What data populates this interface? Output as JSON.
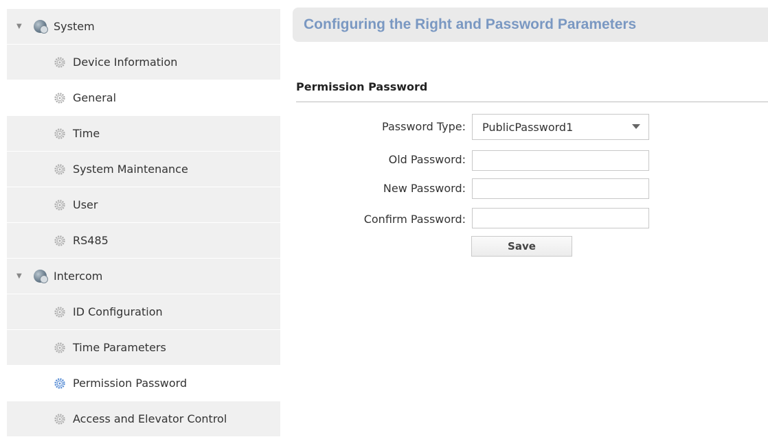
{
  "sidebar": {
    "groups": [
      {
        "label": "System",
        "items": [
          {
            "label": "Device Information"
          },
          {
            "label": "General"
          },
          {
            "label": "Time"
          },
          {
            "label": "System Maintenance"
          },
          {
            "label": "User"
          },
          {
            "label": "RS485"
          }
        ]
      },
      {
        "label": "Intercom",
        "items": [
          {
            "label": "ID Configuration"
          },
          {
            "label": "Time Parameters"
          },
          {
            "label": "Permission Password"
          },
          {
            "label": "Access and Elevator Control"
          }
        ]
      }
    ],
    "active_item": "Permission Password"
  },
  "header": {
    "title": "Configuring the Right and Password Parameters"
  },
  "section": {
    "title": "Permission Password"
  },
  "form": {
    "password_type_label": "Password Type:",
    "password_type_value": "PublicPassword1",
    "old_password_label": "Old Password:",
    "old_password_value": "",
    "new_password_label": "New Password:",
    "new_password_value": "",
    "confirm_password_label": "Confirm Password:",
    "confirm_password_value": "",
    "save_label": "Save"
  },
  "icons": {
    "group_icon": "globe-gear-icon",
    "item_icon": "gear-icon",
    "expand_icon": "caret-down-icon"
  },
  "colors": {
    "header_title": "#7a98c2",
    "active_gear": "#5b8fd6",
    "inactive_gear": "#b0b0b0"
  }
}
